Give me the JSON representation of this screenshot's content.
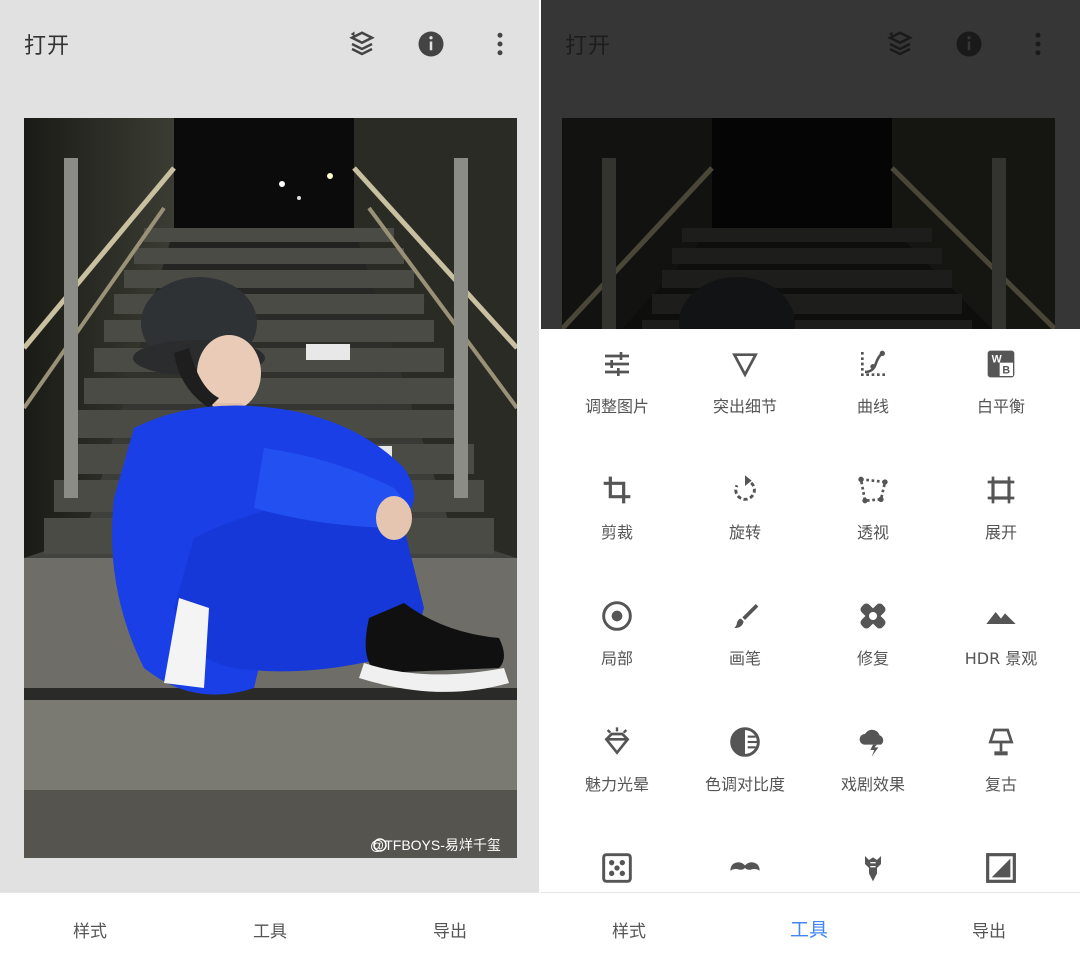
{
  "left_screen": {
    "topbar": {
      "title": "打开"
    },
    "photo": {
      "watermark": "@TFBOYS-易烊千玺"
    },
    "bottom_nav": {
      "tabs": [
        "样式",
        "工具",
        "导出"
      ],
      "active": ""
    }
  },
  "right_screen": {
    "topbar": {
      "title": "打开"
    },
    "tools": [
      {
        "label": "调整图片",
        "icon": "sliders-icon"
      },
      {
        "label": "突出细节",
        "icon": "triangle-icon"
      },
      {
        "label": "曲线",
        "icon": "curve-icon"
      },
      {
        "label": "白平衡",
        "icon": "white-balance-icon"
      },
      {
        "label": "剪裁",
        "icon": "crop-icon"
      },
      {
        "label": "旋转",
        "icon": "rotate-icon"
      },
      {
        "label": "透视",
        "icon": "perspective-icon"
      },
      {
        "label": "展开",
        "icon": "expand-icon"
      },
      {
        "label": "局部",
        "icon": "target-icon"
      },
      {
        "label": "画笔",
        "icon": "brush-icon"
      },
      {
        "label": "修复",
        "icon": "bandage-icon"
      },
      {
        "label": "HDR 景观",
        "icon": "mountain-icon"
      },
      {
        "label": "魅力光晕",
        "icon": "diamond-icon"
      },
      {
        "label": "色调对比度",
        "icon": "tonal-contrast-icon"
      },
      {
        "label": "戏剧效果",
        "icon": "cloud-lightning-icon"
      },
      {
        "label": "复古",
        "icon": "lamp-icon"
      },
      {
        "label": "",
        "icon": "grain-dice-icon"
      },
      {
        "label": "",
        "icon": "mustache-icon"
      },
      {
        "label": "",
        "icon": "guitar-icon"
      },
      {
        "label": "",
        "icon": "frame-icon"
      }
    ],
    "bottom_nav": {
      "tabs": [
        "样式",
        "工具",
        "导出"
      ],
      "active": "工具"
    }
  },
  "colors": {
    "accent": "#4285f4",
    "icon": "#555555",
    "left_bg": "#e1e1e1",
    "dim_bg": "#363636"
  }
}
